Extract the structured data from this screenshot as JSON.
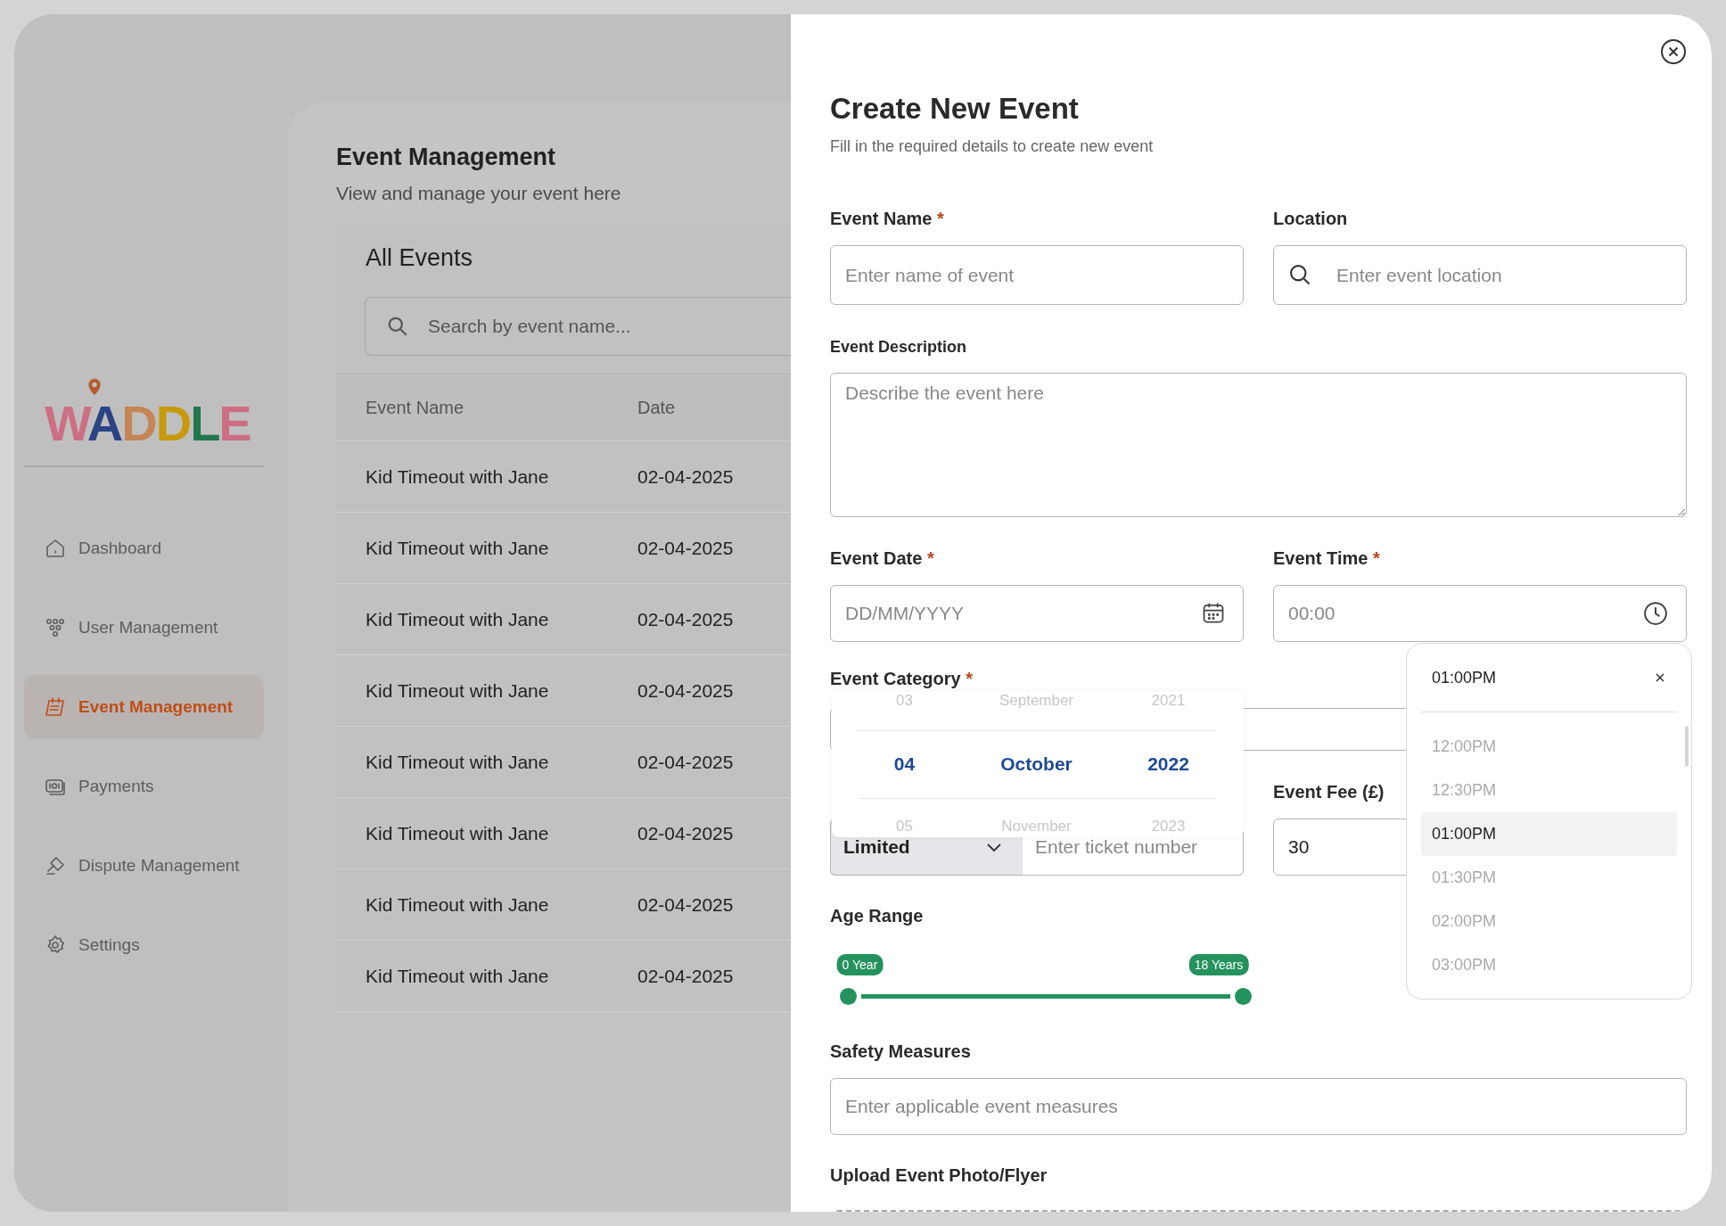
{
  "sidebar": {
    "logo": "WADDLE",
    "items": [
      {
        "label": "Dashboard",
        "selected": false
      },
      {
        "label": "User Management",
        "selected": false
      },
      {
        "label": "Event Management",
        "selected": true
      },
      {
        "label": "Payments",
        "selected": false
      },
      {
        "label": "Dispute Management",
        "selected": false
      },
      {
        "label": "Settings",
        "selected": false
      }
    ]
  },
  "main": {
    "title": "Event Management",
    "subtitle": "View and manage your event here",
    "panel_title": "All Events",
    "search": {
      "placeholder": "Search by event name..."
    },
    "table": {
      "columns": [
        "Event Name",
        "Date"
      ],
      "rows": [
        [
          "Kid Timeout with Jane",
          "02-04-2025"
        ],
        [
          "Kid Timeout with Jane",
          "02-04-2025"
        ],
        [
          "Kid Timeout with Jane",
          "02-04-2025"
        ],
        [
          "Kid Timeout with Jane",
          "02-04-2025"
        ],
        [
          "Kid Timeout with Jane",
          "02-04-2025"
        ],
        [
          "Kid Timeout with Jane",
          "02-04-2025"
        ],
        [
          "Kid Timeout with Jane",
          "02-04-2025"
        ],
        [
          "Kid Timeout with Jane",
          "02-04-2025"
        ]
      ]
    }
  },
  "modal": {
    "title": "Create New Event",
    "subtitle": "Fill in the required details to create new event",
    "event_name": {
      "label": "Event Name",
      "required_mark": "*",
      "placeholder": "Enter name of event"
    },
    "location": {
      "label": "Location",
      "placeholder": "Enter event location"
    },
    "description": {
      "label": "Event Description",
      "placeholder": "Describe the event here"
    },
    "event_date": {
      "label": "Event Date",
      "required_mark": "*",
      "placeholder": "DD/MM/YYYY"
    },
    "event_time": {
      "label": "Event Time",
      "required_mark": "*",
      "placeholder": "00:00"
    },
    "event_category": {
      "label": "Event Category",
      "required_mark": "*"
    },
    "tickets": {
      "type": "Limited",
      "placeholder": "Enter ticket number"
    },
    "event_fee": {
      "label": "Event Fee (£)",
      "value": "30"
    },
    "age_range": {
      "label": "Age Range",
      "handles": [
        {
          "label": "0 Year",
          "level": 0
        },
        {
          "label": "18 Years",
          "level": 1
        }
      ]
    },
    "safety": {
      "label": "Safety Measures",
      "placeholder": "Enter applicable event measures"
    },
    "upload": {
      "label": "Upload Event Photo/Flyer"
    }
  },
  "date_picker": {
    "columns": [
      [
        {
          "text": "03",
          "selected": false
        },
        {
          "text": "04",
          "selected": true
        },
        {
          "text": "05",
          "selected": false
        }
      ],
      [
        {
          "text": "September",
          "selected": false
        },
        {
          "text": "October",
          "selected": true
        },
        {
          "text": "November",
          "selected": false
        }
      ],
      [
        {
          "text": "2021",
          "selected": false
        },
        {
          "text": "2022",
          "selected": true
        },
        {
          "text": "2023",
          "selected": false
        }
      ]
    ]
  },
  "time_dropdown": {
    "value": "01:00PM",
    "options": [
      {
        "text": "12:00PM",
        "selected": false
      },
      {
        "text": "12:30PM",
        "selected": false
      },
      {
        "text": "01:00PM",
        "selected": true
      },
      {
        "text": "01:30PM",
        "selected": false
      },
      {
        "text": "02:00PM",
        "selected": false
      },
      {
        "text": "03:00PM",
        "selected": false
      }
    ]
  }
}
